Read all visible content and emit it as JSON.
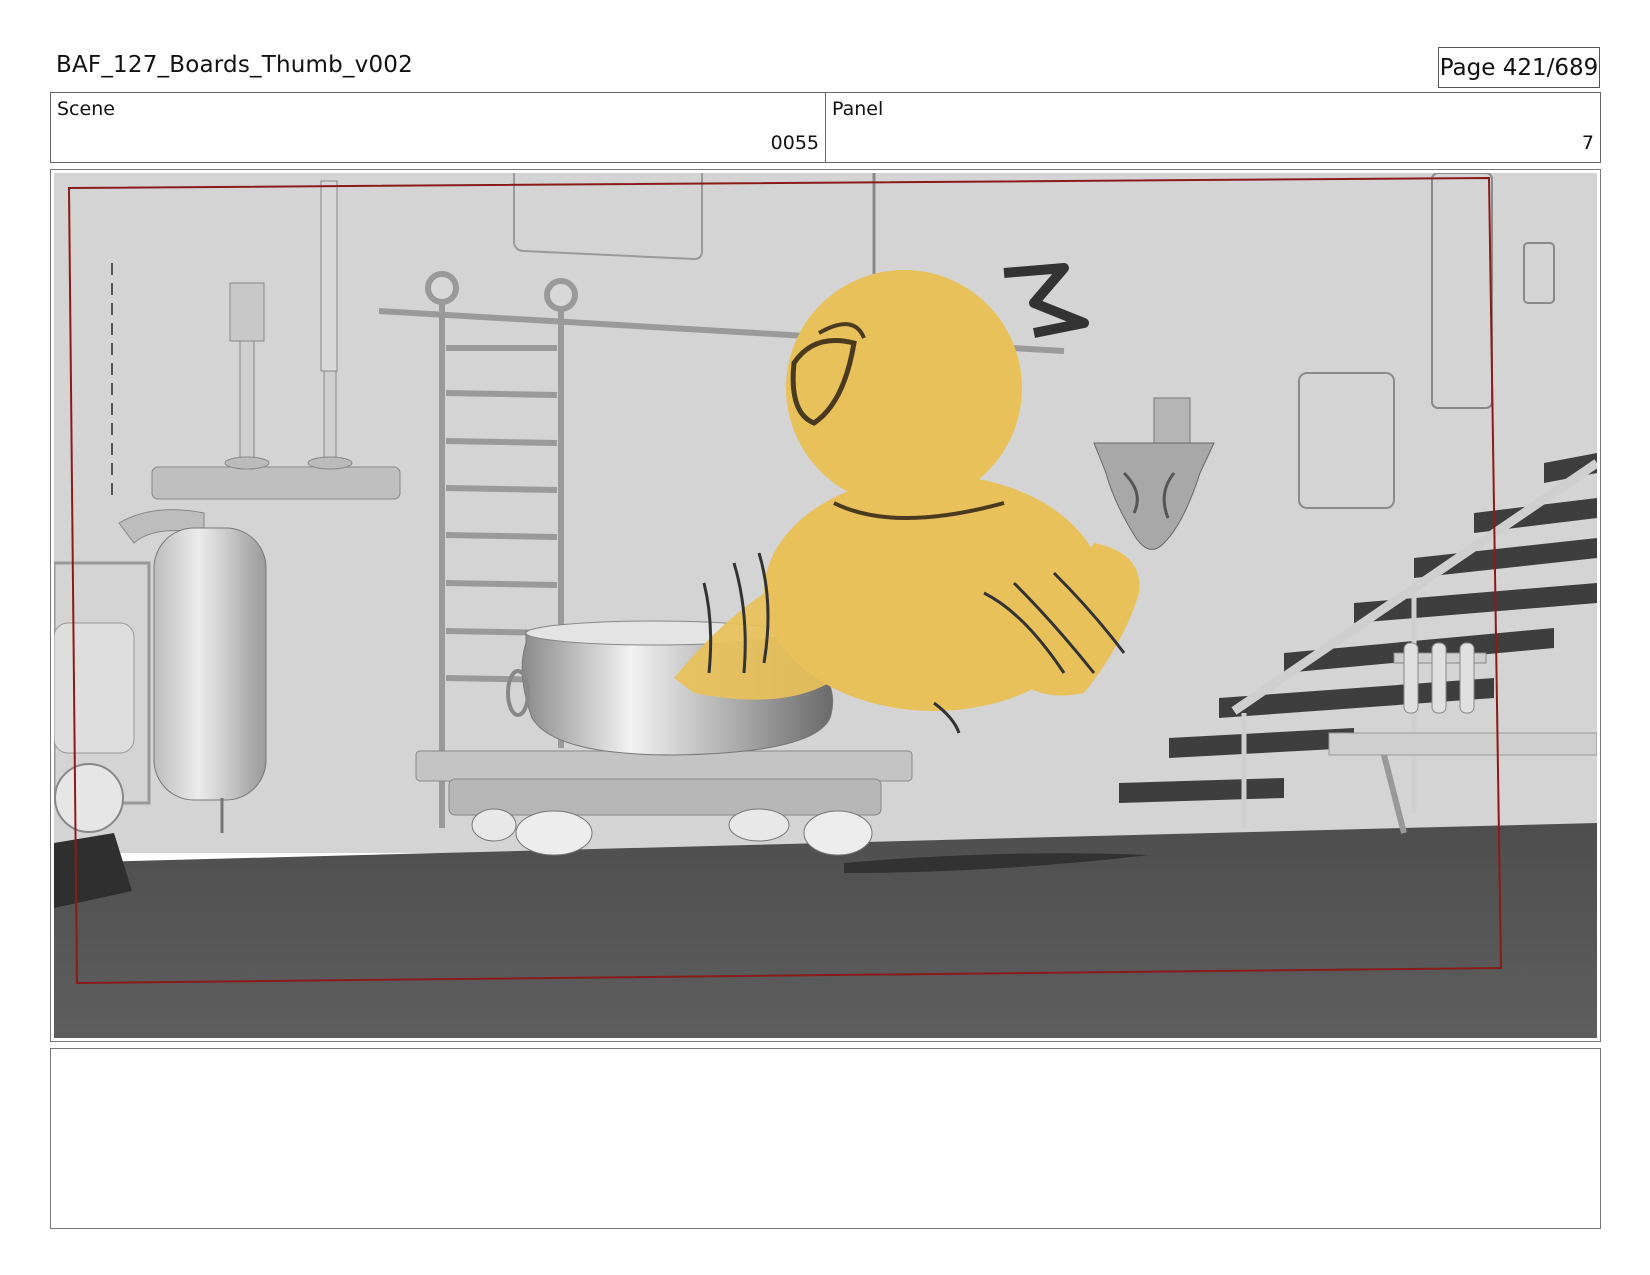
{
  "header": {
    "title": "BAF_127_Boards_Thumb_v002",
    "page": "Page 421/689"
  },
  "info": {
    "scene_label": "Scene",
    "scene_value": "0055",
    "panel_label": "Panel",
    "panel_value": "7"
  },
  "colors": {
    "bird": "#e8c15a",
    "safe_frame": "#8b1a1a",
    "floor": "#5a5a5a",
    "wall": "#d4d4d4"
  },
  "notes": {
    "text": ""
  }
}
